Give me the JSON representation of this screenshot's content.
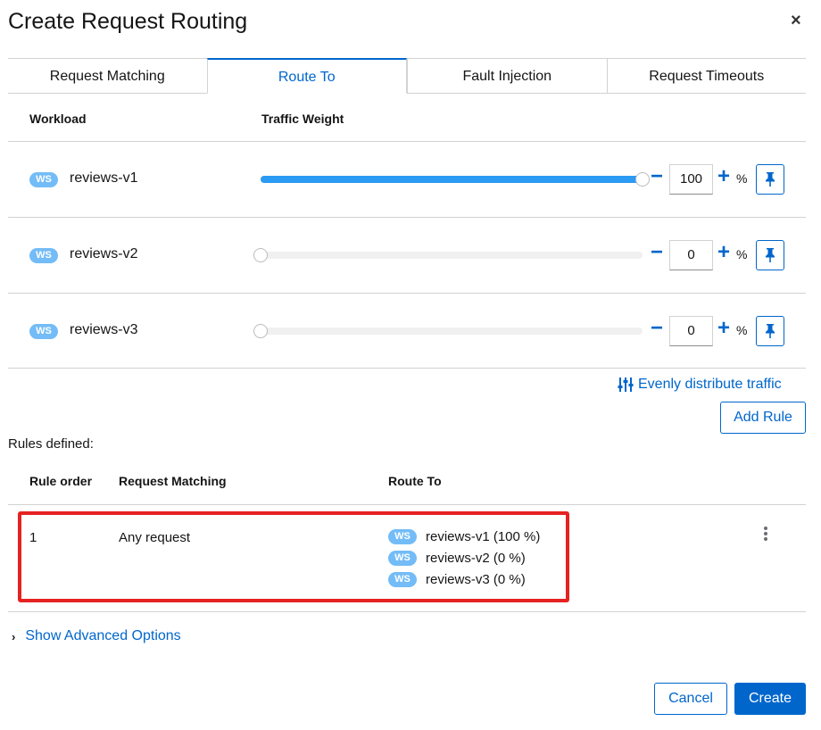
{
  "dialog": {
    "title": "Create Request Routing"
  },
  "tabs": [
    {
      "label": "Request Matching"
    },
    {
      "label": "Route To",
      "active": true
    },
    {
      "label": "Fault Injection"
    },
    {
      "label": "Request Timeouts"
    }
  ],
  "table": {
    "col_workload": "Workload",
    "col_weight": "Traffic Weight"
  },
  "workloads": [
    {
      "badge": "WS",
      "name": "reviews-v1",
      "weight": "100",
      "percent_fill": 100,
      "plus": "+",
      "minus": "−",
      "pct": "%"
    },
    {
      "badge": "WS",
      "name": "reviews-v2",
      "weight": "0",
      "percent_fill": 0,
      "plus": "+",
      "minus": "−",
      "pct": "%"
    },
    {
      "badge": "WS",
      "name": "reviews-v3",
      "weight": "0",
      "percent_fill": 0,
      "plus": "+",
      "minus": "−",
      "pct": "%"
    }
  ],
  "even_distribute": "Evenly distribute traffic",
  "add_rule": "Add Rule",
  "rules": {
    "label": "Rules defined:",
    "col_order": "Rule order",
    "col_match": "Request Matching",
    "col_route": "Route To",
    "items": [
      {
        "order": "1",
        "match": "Any request",
        "routes": [
          {
            "badge": "WS",
            "text": "reviews-v1 (100 %)"
          },
          {
            "badge": "WS",
            "text": "reviews-v2 (0 %)"
          },
          {
            "badge": "WS",
            "text": "reviews-v3 (0 %)"
          }
        ]
      }
    ]
  },
  "advanced": "Show Advanced Options",
  "footer": {
    "cancel": "Cancel",
    "create": "Create"
  },
  "colors": {
    "primary": "#0066cc",
    "badge": "#73bcf7",
    "highlight": "#e52222"
  },
  "icons": {
    "close": "close-icon",
    "pin": "pin-icon",
    "equalizer": "sliders-icon",
    "more": "kebab-icon",
    "expand": "chevron-right-icon"
  }
}
